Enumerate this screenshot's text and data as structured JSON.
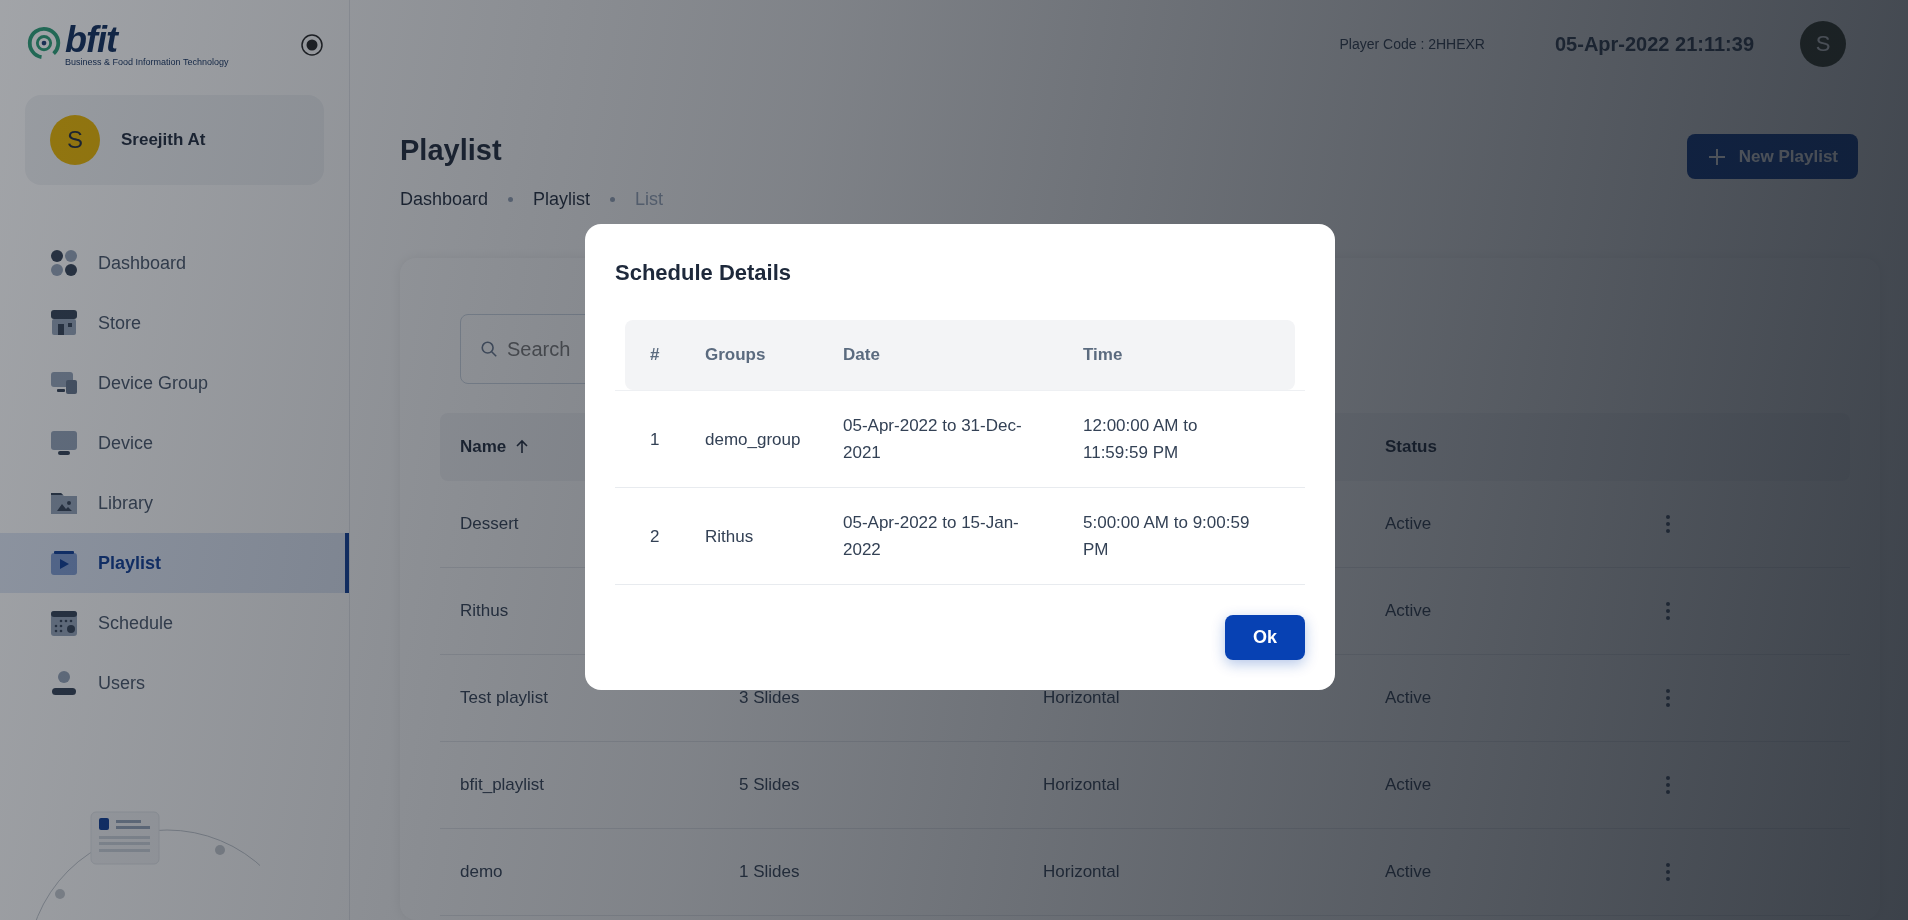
{
  "brand": {
    "name": "bfit",
    "tagline": "Business & Food Information Technology"
  },
  "user": {
    "initial": "S",
    "name": "Sreejith At"
  },
  "sidebar": {
    "items": [
      {
        "label": "Dashboard",
        "kind": "dashboard",
        "selected": false
      },
      {
        "label": "Store",
        "kind": "store",
        "selected": false
      },
      {
        "label": "Device Group",
        "kind": "devices",
        "selected": false
      },
      {
        "label": "Device",
        "kind": "monitor",
        "selected": false
      },
      {
        "label": "Library",
        "kind": "folder",
        "selected": false
      },
      {
        "label": "Playlist",
        "kind": "play",
        "selected": true
      },
      {
        "label": "Schedule",
        "kind": "calendar",
        "selected": false
      },
      {
        "label": "Users",
        "kind": "user",
        "selected": false
      }
    ]
  },
  "header": {
    "player_code": "Player Code : 2HHEXR",
    "datetime": "05-Apr-2022 21:11:39",
    "avatar_initial": "S"
  },
  "page": {
    "title": "Playlist",
    "breadcrumb": [
      "Dashboard",
      "Playlist",
      "List"
    ],
    "new_button": "New Playlist"
  },
  "search": {
    "placeholder": "Search"
  },
  "table": {
    "columns": {
      "name": "Name",
      "status": "Status"
    },
    "rows": [
      {
        "name": "Dessert",
        "status": "Active"
      },
      {
        "name": "Rithus",
        "status": "Active"
      },
      {
        "name": "Test playlist",
        "slides": "3 Slides",
        "orientation": "Horizontal",
        "status": "Active"
      },
      {
        "name": "bfit_playlist",
        "slides": "5 Slides",
        "orientation": "Horizontal",
        "status": "Active"
      },
      {
        "name": "demo",
        "slides": "1 Slides",
        "orientation": "Horizontal",
        "status": "Active"
      }
    ]
  },
  "dialog": {
    "title": "Schedule Details",
    "columns": [
      "#",
      "Groups",
      "Date",
      "Time"
    ],
    "rows": [
      [
        "1",
        "demo_group",
        "05-Apr-2022 to 31-Dec-2021",
        "12:00:00 AM to 11:59:59 PM"
      ],
      [
        "2",
        "Rithus",
        "05-Apr-2022 to 15-Jan-2022",
        "5:00:00 AM to 9:00:59 PM"
      ]
    ],
    "ok_button": "Ok"
  }
}
